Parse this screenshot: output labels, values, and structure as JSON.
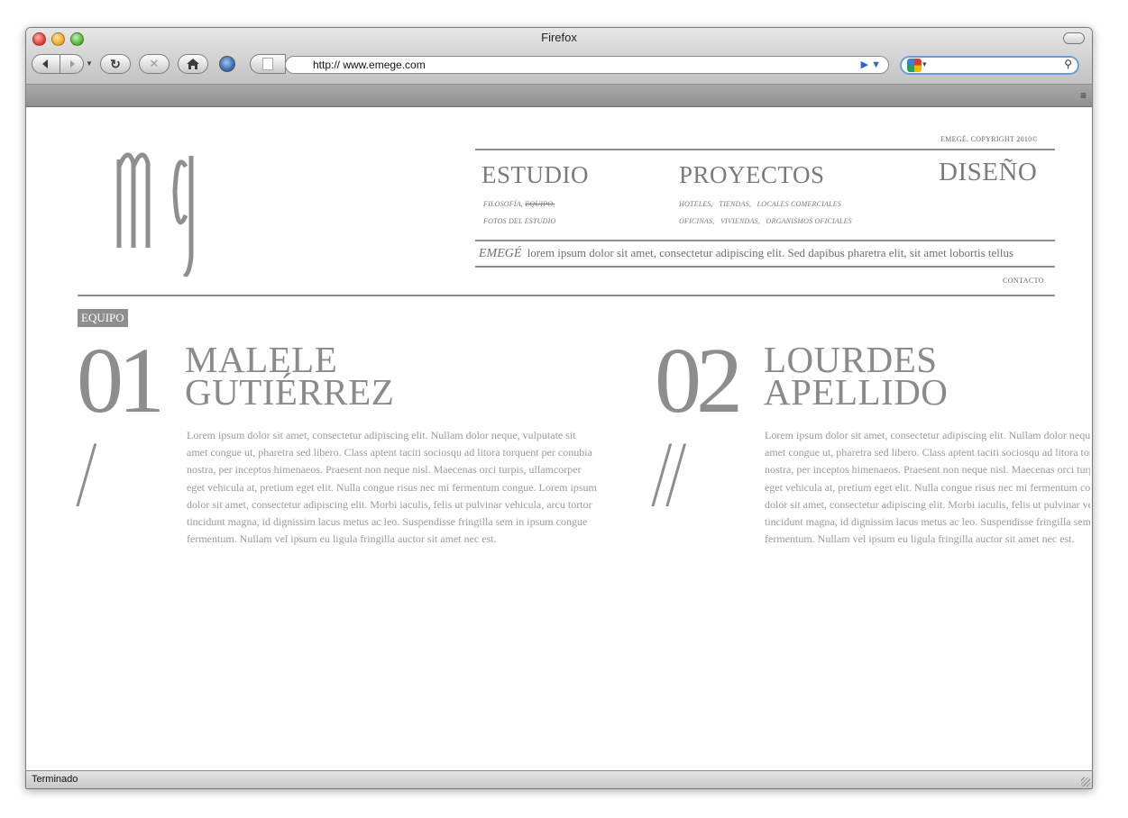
{
  "window": {
    "title": "Firefox",
    "url": "http:// www.emege.com",
    "status": "Terminado",
    "traffic_lights": [
      "#ee5b50",
      "#f5b940",
      "#66c14a"
    ]
  },
  "toolbar": {
    "back_icon": "back-arrow-icon",
    "forward_icon": "forward-arrow-icon",
    "reload_icon": "reload-icon",
    "stop_icon": "stop-icon",
    "home_icon": "home-icon",
    "bookmark_icon": "bookmark-icon",
    "search_provider_icon": "google-icon"
  },
  "site": {
    "logo": "mg",
    "copyright": "EMEGÉ. COPYRIGHT 2010©",
    "nav": {
      "estudio": {
        "label": "ESTUDIO",
        "sub1a": "FILOSOFÍA,",
        "sub1b": "EQUIPO,",
        "sub2": "FOTOS DEL ESTUDIO"
      },
      "proyectos": {
        "label": "PROYECTOS",
        "sub1": "HOTELES,   TIENDAS,   LOCALES COMERCIALES",
        "sub2": "OFICINAS,   VIVIENDAS,   ORGANISMOS OFICIALES"
      },
      "diseno": {
        "label": "DISEÑO"
      }
    },
    "tagline_brand": "EMEGÉ",
    "tagline_text": "lorem ipsum dolor sit amet, consectetur adipiscing elit. Sed dapibus pharetra elit, sit amet lobortis tellus",
    "contacto": "CONTACTO",
    "section_badge": "EQUIPO",
    "members": [
      {
        "number": "01",
        "slash": "/",
        "first": "MALELE",
        "last": "GUTIÉRREZ",
        "bio": "Lorem ipsum dolor sit amet, consectetur adipiscing elit. Nullam dolor neque, vulputate sit amet congue ut, pharetra sed libero. Class aptent taciti sociosqu ad litora torquent per conubia nostra, per inceptos himenaeos. Praesent non neque nisl. Maecenas orci turpis, ullamcorper eget vehicula at, pretium eget elit. Nulla congue risus nec mi fermentum congue. Lorem ipsum dolor sit amet, consectetur adipiscing elit. Morbi iaculis, felis ut pulvinar vehicula, arcu tortor tincidunt magna, id dignissim lacus metus ac leo. Suspendisse fringilla sem in ipsum congue fermentum. Nullam vel ipsum eu ligula fringilla auctor sit amet nec est."
      },
      {
        "number": "02",
        "slash": "//",
        "first": "LOURDES",
        "last": "APELLIDO",
        "bio": "Lorem ipsum dolor sit amet, consectetur adipiscing elit. Nullam dolor neque, vulputate sit amet congue ut, pharetra sed libero. Class aptent taciti sociosqu ad litora torquent per conubia nostra, per inceptos himenaeos. Praesent non neque nisl. Maecenas orci turpis, ullamcorper eget vehicula at, pretium eget elit. Nulla congue risus nec mi fermentum congue. Lorem ipsum dolor sit amet, consectetur adipiscing elit. Morbi iaculis, felis ut pulvinar vehicula, arcu tortor tincidunt magna, id dignissim lacus metus ac leo. Suspendisse fringilla sem in ipsum congue fermentum. Nullam vel ipsum eu ligula fringilla auctor sit amet nec est."
      }
    ]
  }
}
